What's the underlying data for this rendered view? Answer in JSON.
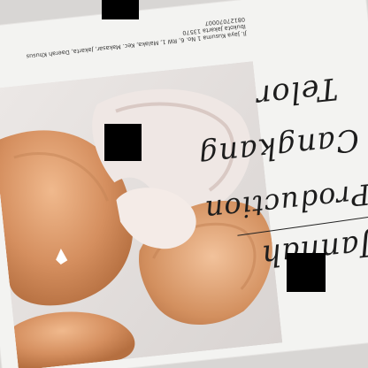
{
  "card": {
    "handwriting": {
      "line1": "Jannah",
      "line2": "Production",
      "line3": "Cangkang",
      "line4": "Telor"
    },
    "address": {
      "line1": "Jl. Jaya Kusuma 1 No. 6, RW 1, Malaka, Kec. Makasar, Jakarta, Daerah Khusus",
      "line2": "Ibukota Jakarta 13570",
      "line3": "08127070007"
    }
  },
  "colors": {
    "paper": "#f3f3f1",
    "eggshell": "#d79a6e",
    "eggshell_shadow": "#b97548",
    "membrane": "#f1e6e2",
    "background": "#e9e5e3",
    "redaction": "#000000"
  }
}
